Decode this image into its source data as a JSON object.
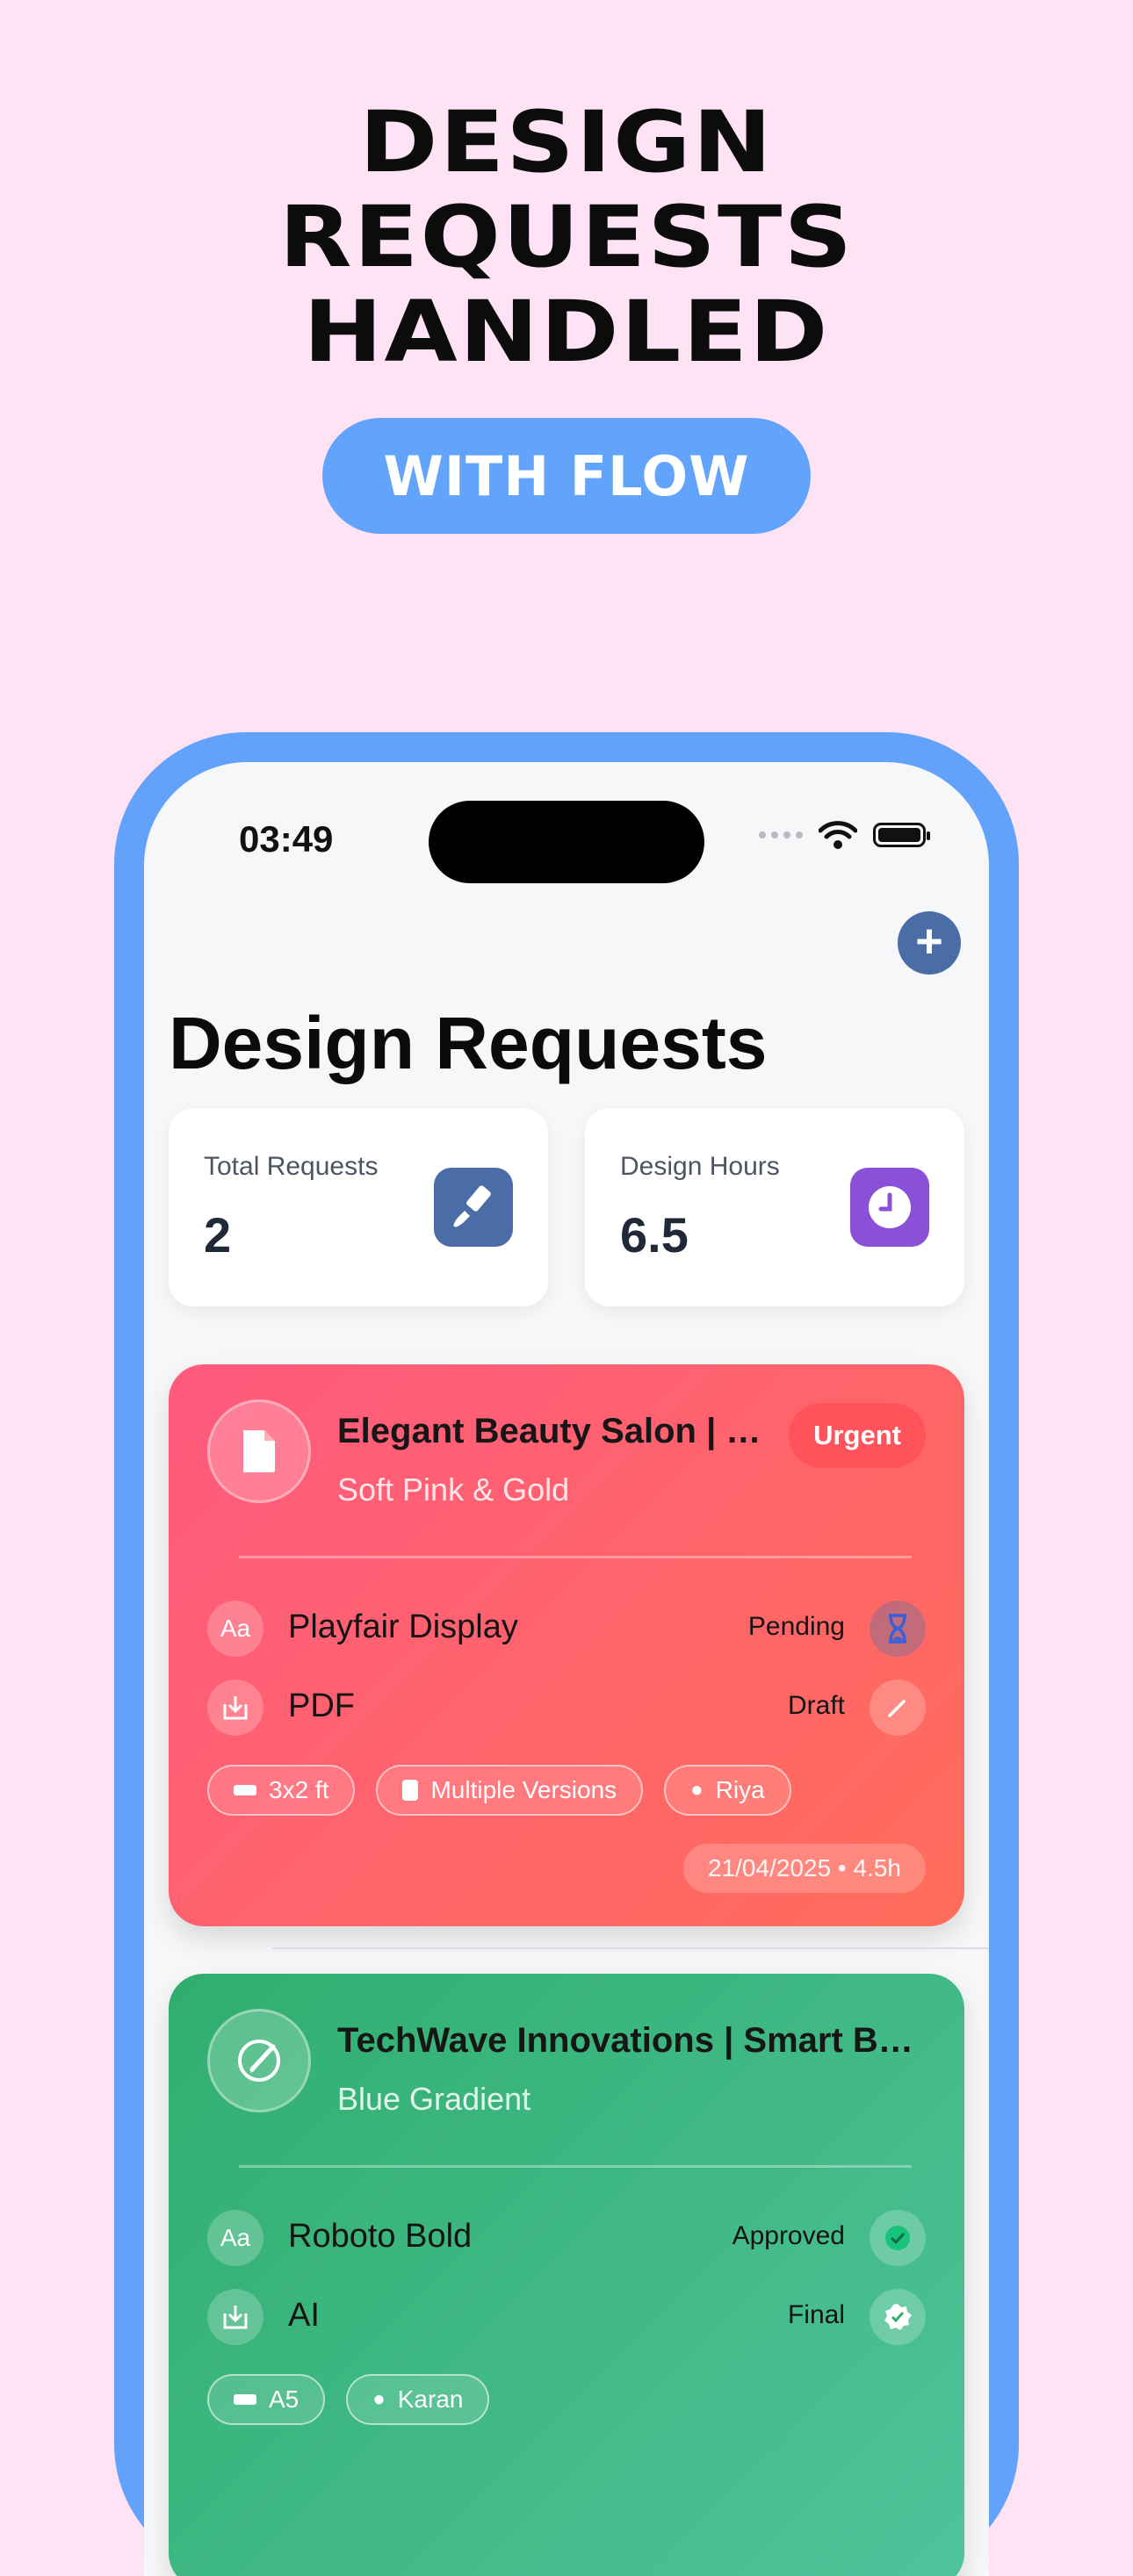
{
  "hero": {
    "line1": "DESIGN",
    "line2": "REQUESTS",
    "line3": "HANDLED",
    "pill": "WITH FLOW"
  },
  "status_bar": {
    "time": "03:49"
  },
  "header": {
    "title": "Design Requests"
  },
  "stats": [
    {
      "label": "Total Requests",
      "value": "2",
      "icon": "paintbrush-icon",
      "color": "#4B6DA7"
    },
    {
      "label": "Design Hours",
      "value": "6.5",
      "icon": "clock-icon",
      "color": "#8B4FD8"
    }
  ],
  "requests": [
    {
      "title": "Elegant Beauty Salon | Brochure",
      "subtitle": "Soft Pink & Gold",
      "priority": "Urgent",
      "font_icon_text": "Aa",
      "font": "Playfair Display",
      "font_status": "Pending",
      "format": "PDF",
      "format_status": "Draft",
      "chips": [
        "3x2 ft",
        "Multiple Versions",
        "Riya"
      ],
      "date": "21/04/2025 • 4.5h",
      "colors": [
        "#FF5A7E",
        "#FF6D5A"
      ]
    },
    {
      "title": "TechWave Innovations | Smart Banner",
      "subtitle": "Blue Gradient",
      "font_icon_text": "Aa",
      "font": "Roboto Bold",
      "font_status": "Approved",
      "format": "AI",
      "format_status": "Final",
      "chips": [
        "A5",
        "Karan"
      ],
      "colors": [
        "#30AE6E",
        "#4FC39B"
      ]
    }
  ]
}
